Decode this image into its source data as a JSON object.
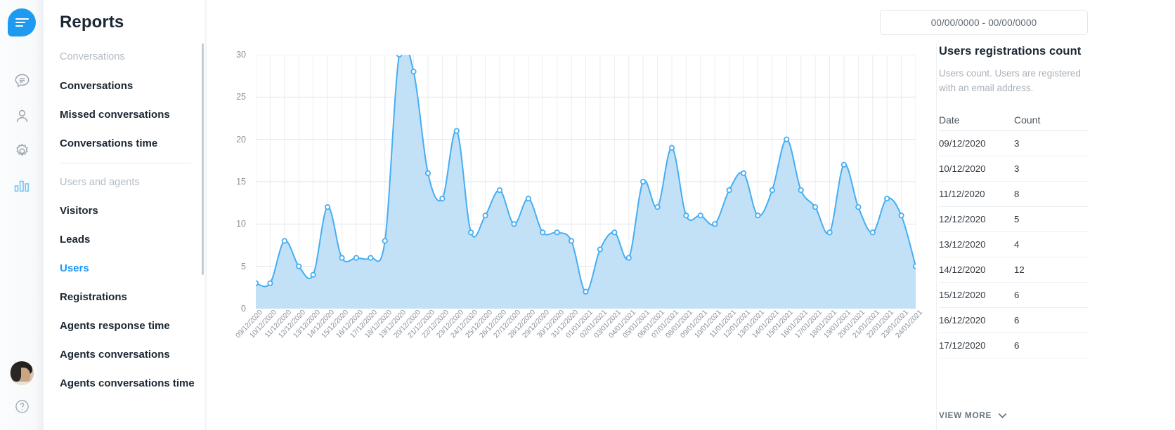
{
  "rail": {
    "logo": {
      "name": "app-logo"
    },
    "icons": [
      {
        "name": "conversations-icon",
        "active": false
      },
      {
        "name": "contacts-icon",
        "active": false
      },
      {
        "name": "settings-gear-icon",
        "active": false
      },
      {
        "name": "reports-bar-chart-icon",
        "active": true
      }
    ],
    "avatar_name": "user-avatar",
    "help_icon": "help-circle-icon"
  },
  "nav": {
    "title": "Reports",
    "groups": [
      {
        "label": "Conversations",
        "items": [
          {
            "label": "Conversations",
            "active": false
          },
          {
            "label": "Missed conversations",
            "active": false
          },
          {
            "label": "Conversations time",
            "active": false
          }
        ]
      },
      {
        "label": "Users and agents",
        "items": [
          {
            "label": "Visitors",
            "active": false
          },
          {
            "label": "Leads",
            "active": false
          },
          {
            "label": "Users",
            "active": true
          },
          {
            "label": "Registrations",
            "active": false
          },
          {
            "label": "Agents response time",
            "active": false
          },
          {
            "label": "Agents conversations",
            "active": false
          },
          {
            "label": "Agents conversations time",
            "active": false
          }
        ]
      }
    ]
  },
  "header": {
    "date_range_value": "00/00/0000 - 00/00/0000",
    "date_range_placeholder": "00/00/0000 - 00/00/0000"
  },
  "right_panel": {
    "title": "Users registrations count",
    "description": "Users count. Users are registered with an email address.",
    "columns": [
      "Date",
      "Count"
    ],
    "rows": [
      {
        "date": "09/12/2020",
        "count": "3"
      },
      {
        "date": "10/12/2020",
        "count": "3"
      },
      {
        "date": "11/12/2020",
        "count": "8"
      },
      {
        "date": "12/12/2020",
        "count": "5"
      },
      {
        "date": "13/12/2020",
        "count": "4"
      },
      {
        "date": "14/12/2020",
        "count": "12"
      },
      {
        "date": "15/12/2020",
        "count": "6"
      },
      {
        "date": "16/12/2020",
        "count": "6"
      },
      {
        "date": "17/12/2020",
        "count": "6"
      }
    ],
    "view_more_label": "VIEW MORE",
    "view_more_icon": "chevron-down-icon"
  },
  "colors": {
    "accent": "#2196f3",
    "line": "#45aef2",
    "area_fill": "#bfdff7",
    "grid": "#e9edf1",
    "text_dark": "#1b2733",
    "text_muted": "#a8b0b8"
  },
  "chart_data": {
    "type": "area",
    "title": "Users registrations count",
    "xlabel": "",
    "ylabel": "",
    "ylim": [
      0,
      30
    ],
    "yticks": [
      0,
      5,
      10,
      15,
      20,
      25,
      30
    ],
    "grid": true,
    "legend": "none",
    "categories": [
      "09/12/2020",
      "10/12/2020",
      "11/12/2020",
      "12/12/2020",
      "13/12/2020",
      "14/12/2020",
      "15/12/2020",
      "16/12/2020",
      "17/12/2020",
      "18/12/2020",
      "19/12/2020",
      "20/12/2020",
      "21/12/2020",
      "22/12/2020",
      "23/12/2020",
      "24/12/2020",
      "25/12/2020",
      "26/12/2020",
      "27/12/2020",
      "28/12/2020",
      "29/12/2020",
      "30/12/2020",
      "31/12/2020",
      "01/01/2021",
      "02/01/2021",
      "03/01/2021",
      "04/01/2021",
      "05/01/2021",
      "06/01/2021",
      "07/01/2021",
      "08/01/2021",
      "09/01/2021",
      "10/01/2021",
      "11/01/2021",
      "12/01/2021",
      "13/01/2021",
      "14/01/2021",
      "15/01/2021",
      "16/01/2021",
      "17/01/2021",
      "18/01/2021",
      "19/01/2021",
      "20/01/2021",
      "21/01/2021",
      "22/01/2021",
      "23/01/2021",
      "24/01/2021"
    ],
    "values": [
      3,
      3,
      8,
      5,
      4,
      12,
      6,
      6,
      6,
      8,
      30,
      28,
      16,
      13,
      21,
      9,
      11,
      14,
      10,
      13,
      9,
      9,
      8,
      2,
      7,
      9,
      6,
      15,
      12,
      19,
      11,
      11,
      10,
      14,
      16,
      11,
      14,
      20,
      14,
      12,
      9,
      17,
      12,
      9,
      13,
      11,
      5
    ]
  }
}
